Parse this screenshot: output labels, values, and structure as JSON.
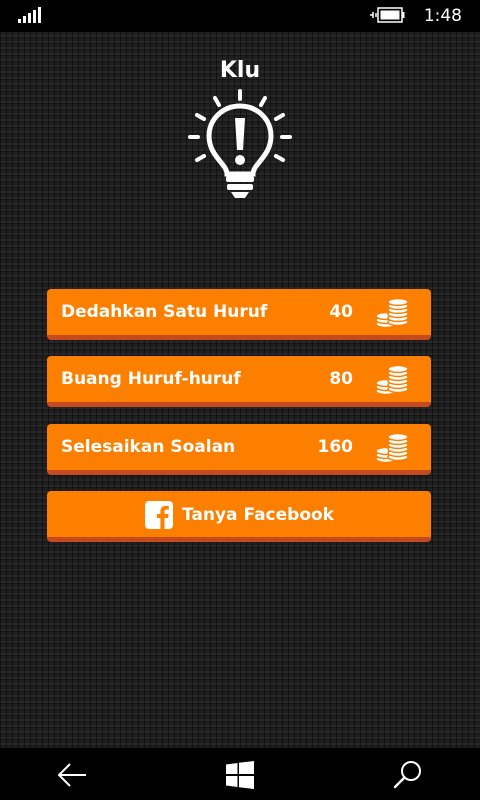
{
  "status_bar": {
    "time": "1:48"
  },
  "header": {
    "title": "Klu",
    "icon": "lightbulb-exclamation-icon"
  },
  "hints": [
    {
      "label": "Dedahkan Satu Huruf",
      "cost": "40",
      "icon": "coins-icon"
    },
    {
      "label": "Buang Huruf-huruf",
      "cost": "80",
      "icon": "coins-icon"
    },
    {
      "label": "Selesaikan Soalan",
      "cost": "160",
      "icon": "coins-icon"
    }
  ],
  "facebook": {
    "label": "Tanya Facebook",
    "icon": "facebook-icon"
  },
  "nav": {
    "back": "back-arrow-icon",
    "home": "windows-logo-icon",
    "search": "search-icon"
  },
  "colors": {
    "button": "#fd7f00",
    "button_shadow": "#c54a1f",
    "background": "#1f1f1f"
  }
}
